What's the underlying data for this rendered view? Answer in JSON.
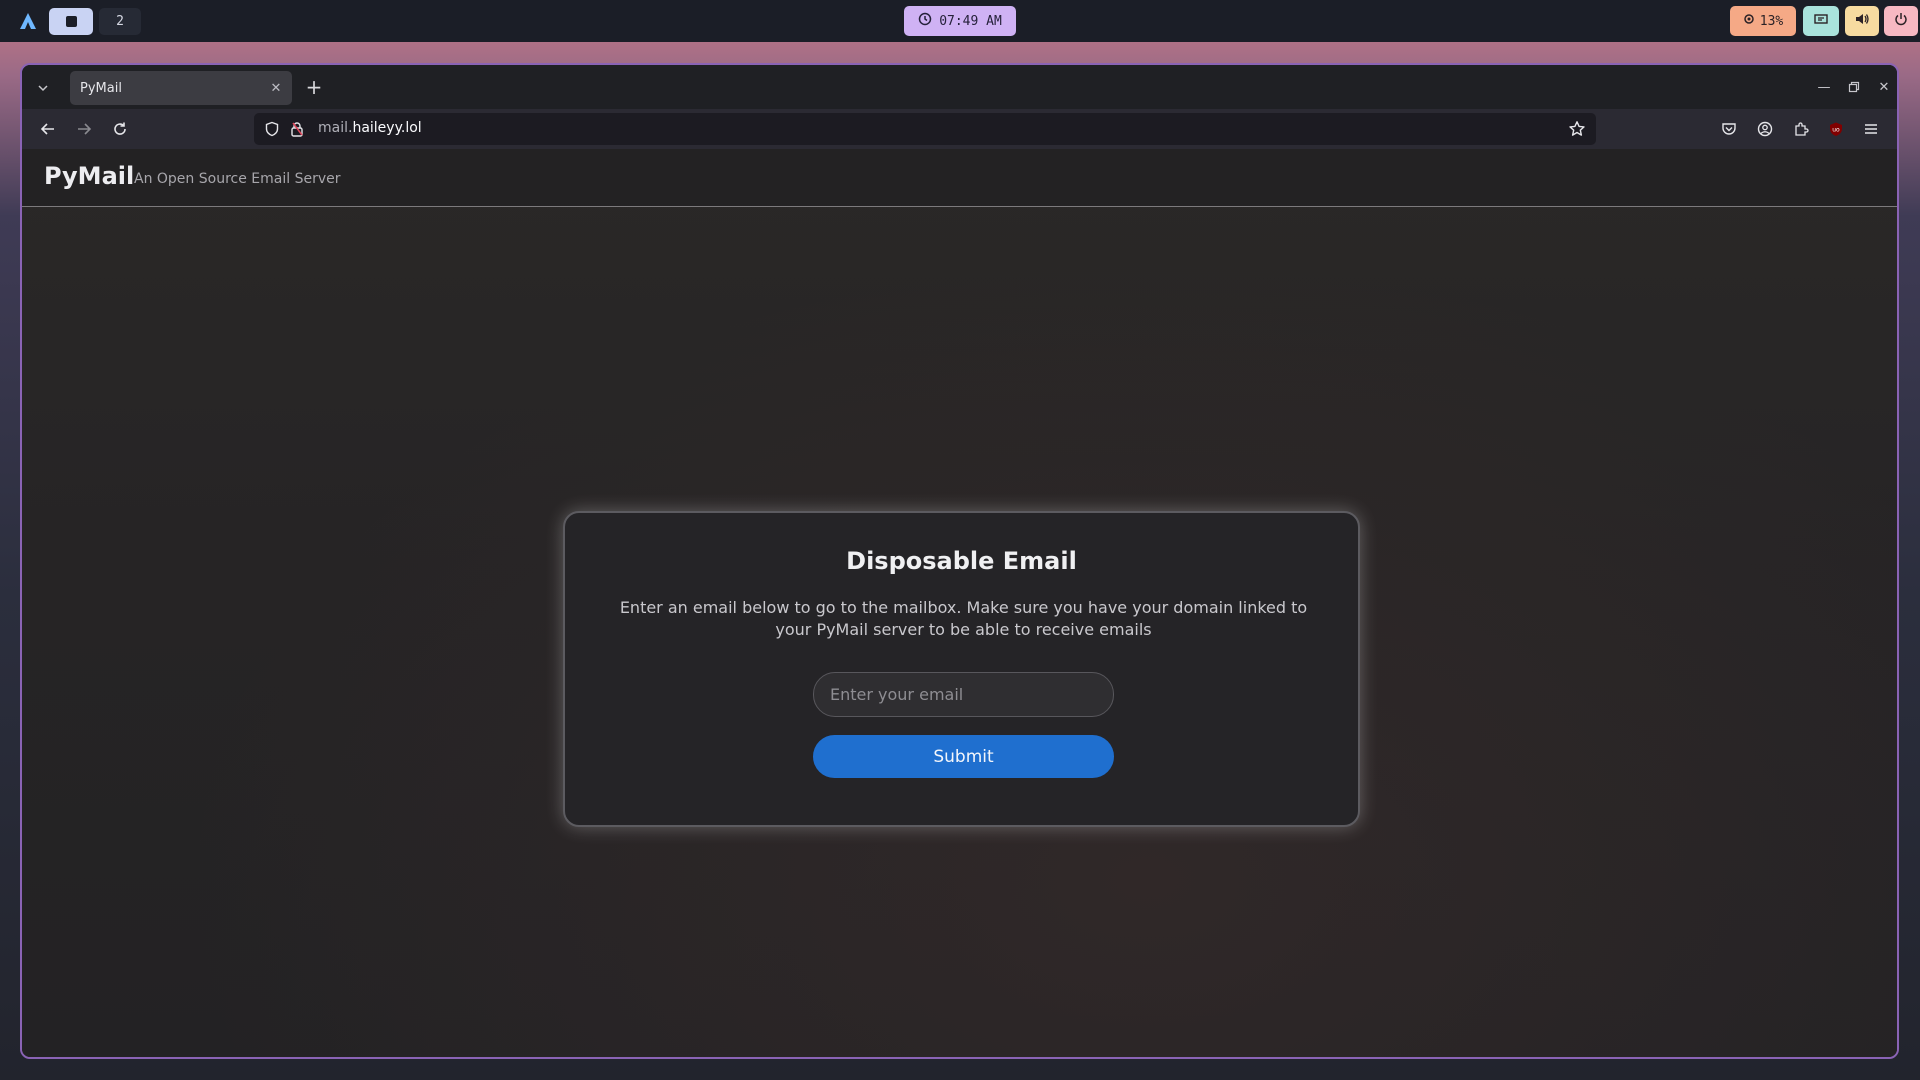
{
  "taskbar": {
    "workspaces": [
      {
        "label": "",
        "active": true
      },
      {
        "label": "2",
        "active": false
      }
    ],
    "clock": "07:49 AM",
    "cpu": "13%",
    "icons": [
      "launcher-logo-icon",
      "clock-icon",
      "cpu-icon",
      "network-icon",
      "volume-icon",
      "power-icon"
    ]
  },
  "browser": {
    "tab_title": "PyMail",
    "url_subdomain": "mail.",
    "url_domain": "haileyy.lol"
  },
  "site": {
    "title": "PyMail",
    "tagline": "An Open Source Email Server"
  },
  "card": {
    "title": "Disposable Email",
    "description": "Enter an email below to go to the mailbox. Make sure you have your domain linked to your PyMail server to be able to receive emails",
    "input_value": "",
    "input_placeholder": "Enter your email",
    "submit_label": "Submit"
  },
  "colors": {
    "window_border": "#8a63b5",
    "submit_button": "#1f6fcf",
    "clock_pill": "#cfb2f4"
  }
}
